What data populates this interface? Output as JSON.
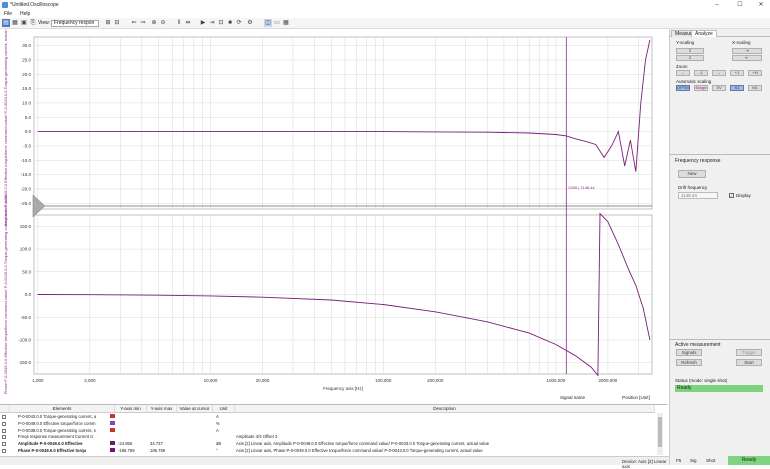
{
  "window": {
    "title": "*Untitled.Oscilloscope",
    "minimize": "–",
    "maximize": "☐",
    "close": "✕"
  },
  "menu": [
    "File",
    "Help"
  ],
  "toolbar": {
    "view_label": "View:",
    "view_value": "Frequency respon"
  },
  "chart_data": [
    {
      "type": "line",
      "name": "Amplitude",
      "ylabel": "Amplitude P-0-0049.0.0 Effective torque/force command value/ P-0-0043.0.0 Torque-generating current, actual value",
      "yticks": [
        30,
        25,
        20,
        15,
        10,
        5,
        0,
        -5,
        -10,
        -15,
        -20,
        -25
      ],
      "ylim": [
        -27,
        33
      ],
      "cursor_label": "2405 | 1148.44",
      "series": [
        {
          "color": "#7a1f7a",
          "x": [
            1,
            2,
            5,
            10,
            20,
            50,
            100,
            200,
            400,
            700,
            1000,
            1148,
            1300,
            1500,
            1700,
            1900,
            2100,
            2300,
            2500,
            2700,
            2900,
            3100,
            3300,
            3500
          ],
          "values": [
            0,
            0,
            0,
            0,
            0,
            0,
            0,
            -0.1,
            -0.2,
            -0.5,
            -1,
            -1.5,
            -2.5,
            -3.5,
            -4.5,
            -9,
            -5,
            0,
            -12,
            -3,
            -14,
            10,
            25,
            32
          ]
        }
      ]
    },
    {
      "type": "line",
      "name": "Phase",
      "ylabel": "Phase P-0-0049.0.0 Effective torque/force command value/ P-0-0043.0.0 Torque-generating current, actual value",
      "yticks": [
        150,
        100,
        50,
        0,
        -50,
        -100,
        -150
      ],
      "ylim": [
        -175,
        175
      ],
      "series": [
        {
          "color": "#7a1f7a",
          "x": [
            1,
            2,
            5,
            10,
            20,
            50,
            100,
            200,
            400,
            700,
            1000,
            1300,
            1600,
            1750,
            1800,
            2000,
            2300,
            2600,
            2900,
            3200,
            3500
          ],
          "values": [
            0,
            -0.5,
            -1.5,
            -3,
            -6,
            -12,
            -22,
            -38,
            -60,
            -85,
            -110,
            -135,
            -160,
            -178,
            178,
            160,
            110,
            60,
            20,
            -30,
            -100
          ]
        }
      ],
      "xlabel": "Frequency axis [Hz]",
      "xticks": [
        "1,000",
        "2,000",
        "10,000",
        "20,000",
        "100,000",
        "200,000",
        "1000,000",
        "2000,000"
      ],
      "xlim": [
        0.95,
        3600
      ]
    }
  ],
  "plot_footer": {
    "signal_name": "Signal name",
    "position": "Position  [Unit]"
  },
  "sidebar": {
    "tabs": [
      "Measure",
      "Analyze"
    ],
    "y_scaling": "Y-scaling",
    "x_scaling": "X-scaling",
    "zoom": "Zoom",
    "zoom_buttons": [
      "--",
      "-1",
      "--",
      "+1",
      "+N"
    ],
    "auto_scaling": "Automatic scaling",
    "auto_buttons": [
      "OPTIM",
      "Eckge",
      "SV",
      "S1",
      "M1"
    ],
    "freq_response_title": "Frequency response",
    "new_button": "New",
    "drift_label": "Drift frequency",
    "drift_value": "1148.44",
    "display_label": "Display",
    "active_title": "Active measurement",
    "signals_button": "Signals",
    "refresh_button": "Refresh",
    "trigger_button": "Trigger",
    "start_button": "Start",
    "status_label": "Status (mode: single shot)",
    "status_value": "Ready"
  },
  "table": {
    "headers": [
      "Elements",
      "Y-axis min",
      "Y-axis max",
      "Value at cursor",
      "Unit",
      "Description"
    ],
    "rows": [
      {
        "name": "P-0-0043.0.0 Torque-generating current, a",
        "color": "#c0392b",
        "min": "",
        "max": "",
        "val": "",
        "unit": "A",
        "desc": ""
      },
      {
        "name": "P-0-0049.0.0 Effective torque/force comm",
        "color": "#8e44ad",
        "min": "",
        "max": "",
        "val": "",
        "unit": "%",
        "desc": ""
      },
      {
        "name": "P-0-0038.0.0 Torque-generating current, s",
        "color": "#c0392b",
        "min": "",
        "max": "",
        "val": "",
        "unit": "A",
        "desc": ""
      },
      {
        "name": "Freqs response measurement Current ct",
        "color": "",
        "min": "",
        "max": "",
        "val": "",
        "unit": "",
        "desc": "Amplitude 4/3 Offset 3"
      },
      {
        "name": "Amplitude P-0-0049.0.0 Effective",
        "color": "#6a1b6a",
        "min": "-24.956",
        "max": "34.737",
        "val": "",
        "unit": "dB",
        "desc": "Axis [2] Linear axis, Amplitude P-0-0049.0.0 Effective torque/force command value/ P-0-0043.0.0 Torque-generating current, actual value"
      },
      {
        "name": "Phase P-0-0049.0.0 Effective torqu",
        "color": "#6a1b6a",
        "min": "-186.769",
        "max": "185.759",
        "val": "",
        "unit": "°",
        "desc": "Axis [2] Linear axis, Phase P-0-0049.0.0 Effective torque/force command value/ P-0-0043.0.0 Torque-generating current, actual value"
      }
    ]
  },
  "statusbar": {
    "device": "Device: Axis [2] Linear axis",
    "f5": "F5",
    "sig": "Sig",
    "shot": "Shot",
    "ready": "Ready"
  },
  "colors": {
    "curve": "#7a1f7a",
    "ready": "#7ed37e",
    "grid": "#d8d8d8"
  }
}
